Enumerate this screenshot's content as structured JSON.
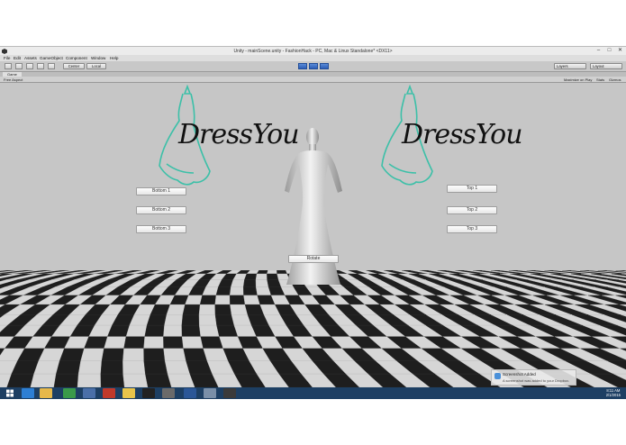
{
  "window": {
    "title": "Unity - mainScene.unity - FashionHack - PC, Mac & Linux Standalone* <DX11>",
    "controls": [
      "–",
      "□",
      "✕"
    ]
  },
  "menu": [
    "File",
    "Edit",
    "Assets",
    "GameObject",
    "Component",
    "Window",
    "Help"
  ],
  "toolbar": {
    "pivot": "Center",
    "space": "Local",
    "layers": "Layers",
    "layout": "Layout"
  },
  "tabs": {
    "game": "Game"
  },
  "game_bar": {
    "aspect": "Free Aspect",
    "maximize": "Maximize on Play",
    "stats": "Stats",
    "gizmos": "Gizmos"
  },
  "scene": {
    "logo_text": "DressYou",
    "bottom_buttons": [
      "Bottom 1",
      "Bottom 2",
      "Bottom 3"
    ],
    "top_buttons": [
      "Top 1",
      "Top 2",
      "Top 3"
    ],
    "rotate": "Rotate",
    "accent_color": "#3cc0a8"
  },
  "notification": {
    "title": "Screenshot Added",
    "body": "A screenshot was added to your Dropbox."
  },
  "taskbar": {
    "time": "8:11 AM",
    "date": "2/1/2015"
  }
}
